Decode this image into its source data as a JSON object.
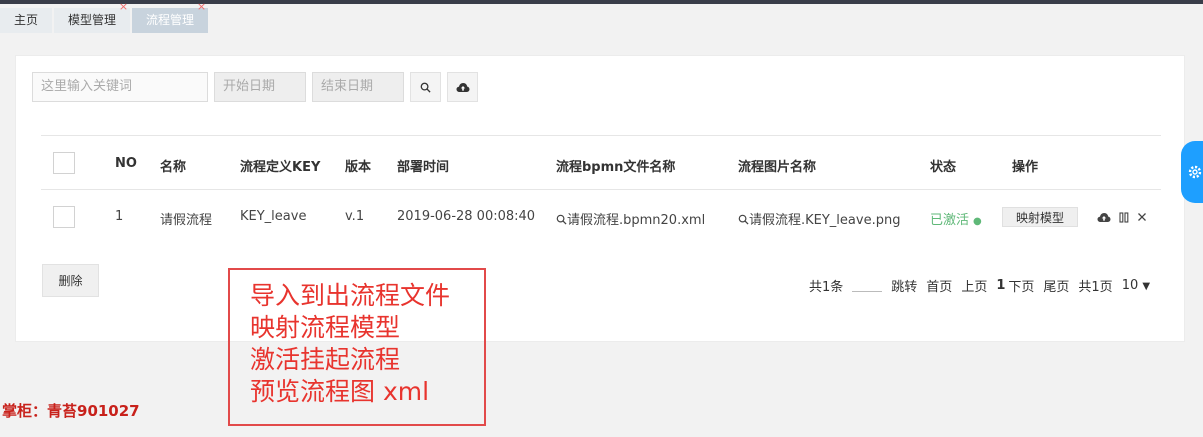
{
  "tabs": [
    {
      "label": "主页",
      "closable": false,
      "active": false
    },
    {
      "label": "模型管理",
      "closable": true,
      "active": false
    },
    {
      "label": "流程管理",
      "closable": true,
      "active": true
    }
  ],
  "tab_close_glyph": "×",
  "search": {
    "keyword_placeholder": "这里输入关键词",
    "start_date_placeholder": "开始日期",
    "end_date_placeholder": "结束日期",
    "search_icon": "search-icon",
    "upload_icon": "cloud-upload-icon"
  },
  "table": {
    "headers": {
      "no": "NO",
      "name": "名称",
      "key": "流程定义KEY",
      "version": "版本",
      "deploy_time": "部署时间",
      "bpmn_file": "流程bpmn文件名称",
      "image_file": "流程图片名称",
      "status": "状态",
      "actions": "操作"
    },
    "rows": [
      {
        "no": "1",
        "name": "请假流程",
        "key": "KEY_leave",
        "version": "v.1",
        "deploy_time": "2019-06-28 00:08:40",
        "bpmn_file": "请假流程.bpmn20.xml",
        "image_file": "请假流程.KEY_leave.png",
        "status": "已激活",
        "map_button": "映射模型"
      }
    ]
  },
  "delete_button": "删除",
  "pager": {
    "total": "共1条",
    "jump": "跳转",
    "first": "首页",
    "prev": "上页",
    "current": "1",
    "next": "下页",
    "last": "尾页",
    "pages": "共1页",
    "page_size": "10"
  },
  "annotation_lines": [
    "导入到出流程文件",
    "映射流程模型",
    "激活挂起流程",
    "预览流程图 xml"
  ],
  "watermark": "掌柜：青苔901027",
  "colors": {
    "accent_blue": "#1e9fff",
    "status_green": "#5fb878",
    "annotation_red": "#e24a4a",
    "watermark_red": "#c8211b"
  }
}
